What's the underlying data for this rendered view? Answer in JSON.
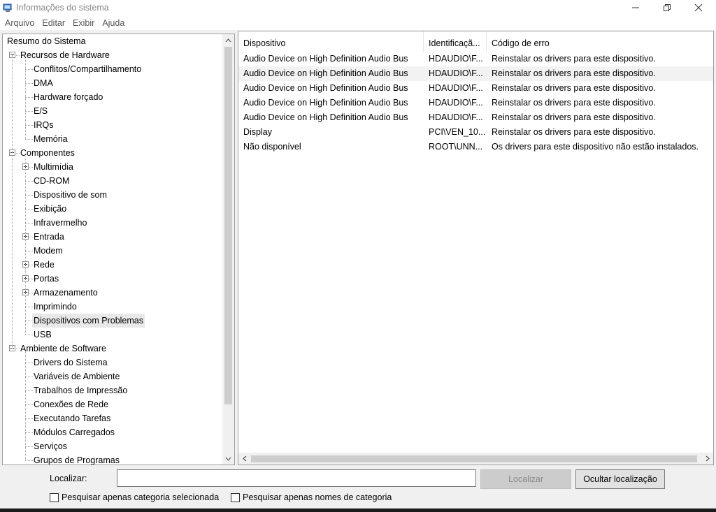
{
  "window": {
    "title": "Informações do sistema",
    "minimize_glyph": "—",
    "maximize_glyph": "❐",
    "close_glyph": "✕"
  },
  "menu": [
    "Arquivo",
    "Editar",
    "Exibir",
    "Ajuda"
  ],
  "tree": [
    {
      "label": "Resumo do Sistema",
      "level": 0,
      "expander": "none"
    },
    {
      "label": "Recursos de Hardware",
      "level": 1,
      "expander": "minus"
    },
    {
      "label": "Conflitos/Compartilhamento",
      "level": 2,
      "expander": "none"
    },
    {
      "label": "DMA",
      "level": 2,
      "expander": "none"
    },
    {
      "label": "Hardware forçado",
      "level": 2,
      "expander": "none"
    },
    {
      "label": "E/S",
      "level": 2,
      "expander": "none"
    },
    {
      "label": "IRQs",
      "level": 2,
      "expander": "none"
    },
    {
      "label": "Memória",
      "level": 2,
      "expander": "none"
    },
    {
      "label": "Componentes",
      "level": 1,
      "expander": "minus"
    },
    {
      "label": "Multimídia",
      "level": 2,
      "expander": "plus"
    },
    {
      "label": "CD-ROM",
      "level": 2,
      "expander": "none"
    },
    {
      "label": "Dispositivo de som",
      "level": 2,
      "expander": "none"
    },
    {
      "label": "Exibição",
      "level": 2,
      "expander": "none"
    },
    {
      "label": "Infravermelho",
      "level": 2,
      "expander": "none"
    },
    {
      "label": "Entrada",
      "level": 2,
      "expander": "plus"
    },
    {
      "label": "Modem",
      "level": 2,
      "expander": "none"
    },
    {
      "label": "Rede",
      "level": 2,
      "expander": "plus"
    },
    {
      "label": "Portas",
      "level": 2,
      "expander": "plus"
    },
    {
      "label": "Armazenamento",
      "level": 2,
      "expander": "plus"
    },
    {
      "label": "Imprimindo",
      "level": 2,
      "expander": "none"
    },
    {
      "label": "Dispositivos com Problemas",
      "level": 2,
      "expander": "none",
      "selected": true
    },
    {
      "label": "USB",
      "level": 2,
      "expander": "none"
    },
    {
      "label": "Ambiente de Software",
      "level": 1,
      "expander": "minus"
    },
    {
      "label": "Drivers do Sistema",
      "level": 2,
      "expander": "none"
    },
    {
      "label": "Variáveis de Ambiente",
      "level": 2,
      "expander": "none"
    },
    {
      "label": "Trabalhos de Impressão",
      "level": 2,
      "expander": "none"
    },
    {
      "label": "Conexões de Rede",
      "level": 2,
      "expander": "none"
    },
    {
      "label": "Executando Tarefas",
      "level": 2,
      "expander": "none"
    },
    {
      "label": "Módulos Carregados",
      "level": 2,
      "expander": "none"
    },
    {
      "label": "Serviços",
      "level": 2,
      "expander": "none"
    },
    {
      "label": "Grupos de Programas",
      "level": 2,
      "expander": "none"
    }
  ],
  "list": {
    "columns": [
      "Dispositivo",
      "Identificaçã...",
      "Código de erro"
    ],
    "rows": [
      [
        "Audio Device on High Definition Audio Bus",
        "HDAUDIO\\F...",
        "Reinstalar os drivers para este dispositivo."
      ],
      [
        "Audio Device on High Definition Audio Bus",
        "HDAUDIO\\F...",
        "Reinstalar os drivers para este dispositivo."
      ],
      [
        "Audio Device on High Definition Audio Bus",
        "HDAUDIO\\F...",
        "Reinstalar os drivers para este dispositivo."
      ],
      [
        "Audio Device on High Definition Audio Bus",
        "HDAUDIO\\F...",
        "Reinstalar os drivers para este dispositivo."
      ],
      [
        "Audio Device on High Definition Audio Bus",
        "HDAUDIO\\F...",
        "Reinstalar os drivers para este dispositivo."
      ],
      [
        "Display",
        "PCI\\VEN_10...",
        "Reinstalar os drivers para este dispositivo."
      ],
      [
        "Não disponível",
        "ROOT\\UNN...",
        "Os drivers para este dispositivo não estão instalados."
      ]
    ],
    "hovered_row": 1
  },
  "find": {
    "label": "Localizar:",
    "value": "",
    "find_button": "Localizar",
    "hide_button": "Ocultar localização",
    "check_selected": "Pesquisar apenas categoria selecionada",
    "check_names": "Pesquisar apenas nomes de categoria"
  },
  "colors": {
    "selected_row": "#e8e8e8",
    "hover_row": "#f2f2f2",
    "scroll_thumb": "#cdcdcd"
  }
}
